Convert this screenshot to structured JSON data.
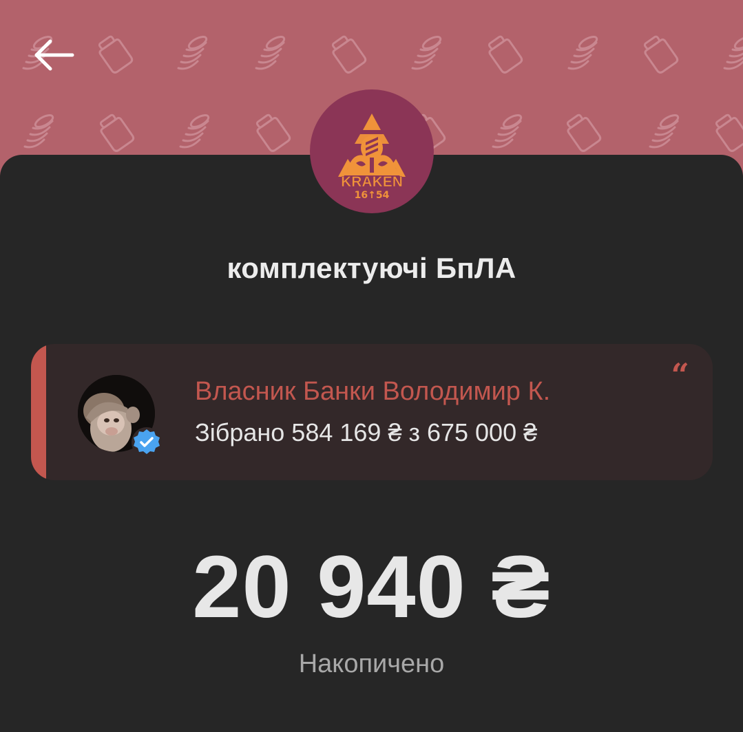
{
  "header": {
    "back_icon": "arrow-left-icon",
    "pattern_icons": [
      "coin-stack-icon",
      "jar-icon"
    ],
    "background_color": "#b3626b"
  },
  "jar": {
    "logo": {
      "wordmark": "KRAKEN",
      "subtext": "16↑54",
      "circle_color": "#8b3556",
      "mark_color": "#f0933a"
    },
    "title": "комплектуючі БпЛА"
  },
  "owner_card": {
    "name": "Власник Банки Володимир К.",
    "collected_text": "Зібрано 584 169 ₴ з 675 000 ₴",
    "quote_glyph": "“",
    "accent_color": "#c3574f",
    "verified_icon": "verified-badge-icon"
  },
  "balance": {
    "amount": "20 940 ₴",
    "label": "Накопичено"
  }
}
